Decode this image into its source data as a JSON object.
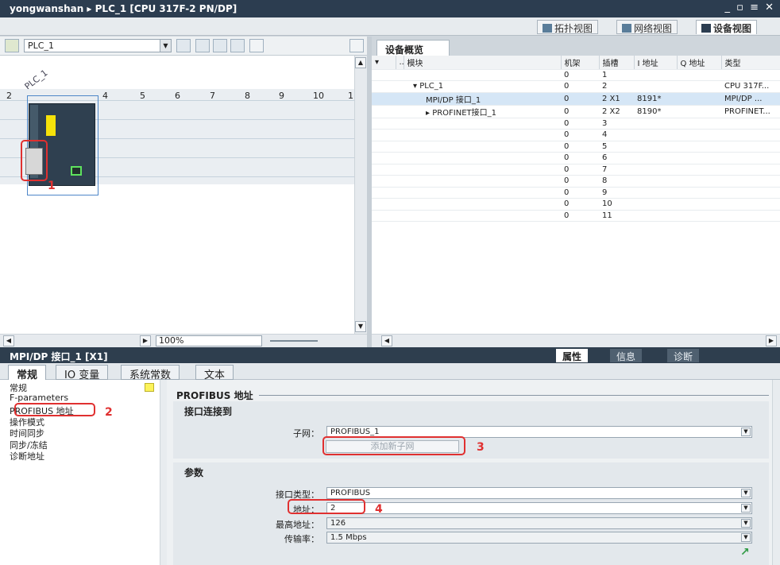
{
  "titlebar": {
    "breadcrumb": "yongwanshan ▸ PLC_1 [CPU 317F-2 PN/DP]",
    "controls": "_ ▫ ≡ ✕"
  },
  "viewbar": {
    "topology": "拓扑视图",
    "network": "网络视图",
    "device": "设备视图"
  },
  "left": {
    "device_combo": "PLC_1",
    "plc_label": "PLC_1",
    "slots": [
      "2",
      "4",
      "5",
      "6",
      "7",
      "8",
      "9",
      "10",
      "1"
    ],
    "zoom": "100%",
    "annotation_1": "1"
  },
  "overview": {
    "tab": "设备概览",
    "columns": [
      "...",
      "模块",
      "机架",
      "插槽",
      "I 地址",
      "Q 地址",
      "类型"
    ],
    "rows": [
      {
        "module": "",
        "rack": "0",
        "slot": "1",
        "i": "",
        "q": "",
        "type": ""
      },
      {
        "module": "▾ PLC_1",
        "rack": "0",
        "slot": "2",
        "i": "",
        "q": "",
        "type": "CPU 317F..."
      },
      {
        "module": "MPI/DP 接口_1",
        "rack": "0",
        "slot": "2 X1",
        "i": "8191*",
        "q": "",
        "type": "MPI/DP ..."
      },
      {
        "module": "▸ PROFINET接口_1",
        "rack": "0",
        "slot": "2 X2",
        "i": "8190*",
        "q": "",
        "type": "PROFINET..."
      },
      {
        "module": "",
        "rack": "0",
        "slot": "3",
        "i": "",
        "q": "",
        "type": ""
      },
      {
        "module": "",
        "rack": "0",
        "slot": "4",
        "i": "",
        "q": "",
        "type": ""
      },
      {
        "module": "",
        "rack": "0",
        "slot": "5",
        "i": "",
        "q": "",
        "type": ""
      },
      {
        "module": "",
        "rack": "0",
        "slot": "6",
        "i": "",
        "q": "",
        "type": ""
      },
      {
        "module": "",
        "rack": "0",
        "slot": "7",
        "i": "",
        "q": "",
        "type": ""
      },
      {
        "module": "",
        "rack": "0",
        "slot": "8",
        "i": "",
        "q": "",
        "type": ""
      },
      {
        "module": "",
        "rack": "0",
        "slot": "9",
        "i": "",
        "q": "",
        "type": ""
      },
      {
        "module": "",
        "rack": "0",
        "slot": "10",
        "i": "",
        "q": "",
        "type": ""
      },
      {
        "module": "",
        "rack": "0",
        "slot": "11",
        "i": "",
        "q": "",
        "type": ""
      }
    ]
  },
  "props": {
    "title": "MPI/DP 接口_1 [X1]",
    "tab_properties": "属性",
    "tab_info": "信息",
    "tab_diag": "诊断",
    "subtabs": [
      "常规",
      "IO 变量",
      "系统常数",
      "文本"
    ],
    "nav": [
      "常规",
      "F-parameters",
      "PROFIBUS 地址",
      "操作模式",
      "时间同步",
      "同步/冻结",
      "诊断地址"
    ],
    "section_title": "PROFIBUS 地址",
    "connect_header": "接口连接到",
    "subnet_label": "子网：",
    "subnet_value": "PROFIBUS_1",
    "add_subnet": "添加新子网",
    "params_header": "参数",
    "if_type_label": "接口类型：",
    "if_type_value": "PROFIBUS",
    "addr_label": "地址：",
    "addr_value": "2",
    "max_addr_label": "最高地址：",
    "max_addr_value": "126",
    "rate_label": "传输率：",
    "rate_value": "1.5 Mbps",
    "annotations": [
      "2",
      "3",
      "4"
    ]
  }
}
